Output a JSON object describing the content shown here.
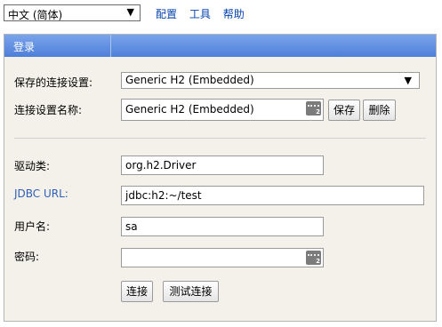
{
  "top": {
    "language": "中文 (简体)",
    "links": [
      "配置",
      "工具",
      "帮助"
    ]
  },
  "login": {
    "title": "登录",
    "saved_settings_label": "保存的连接设置:",
    "saved_settings_value": "Generic H2 (Embedded)",
    "setting_name_label": "连接设置名称:",
    "setting_name_value": "Generic H2 (Embedded)",
    "save_button": "保存",
    "delete_button": "删除",
    "driver_label": "驱动类:",
    "driver_value": "org.h2.Driver",
    "jdbc_label": "JDBC URL:",
    "jdbc_value": "jdbc:h2:~/test",
    "user_label": "用户名:",
    "user_value": "sa",
    "password_label": "密码:",
    "password_value": "",
    "connect_button": "连接",
    "test_button": "测试连接"
  },
  "colors": {
    "accent": "#4e7fd9",
    "link": "#0645ad",
    "jdbc_label": "#2e5fb8"
  }
}
